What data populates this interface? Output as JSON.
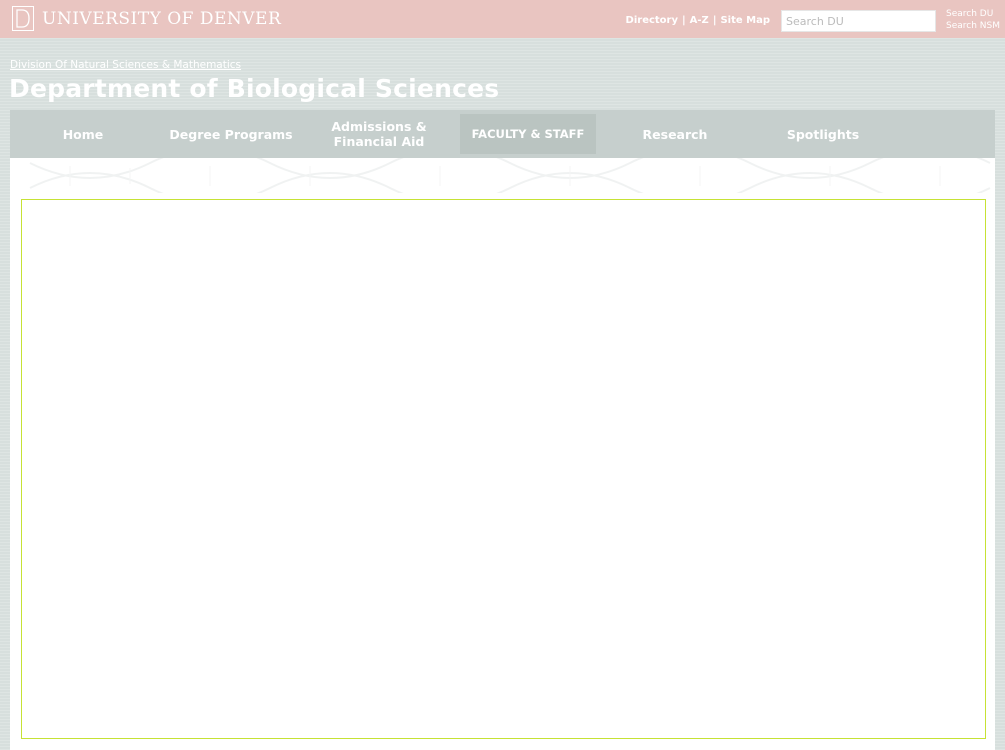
{
  "header": {
    "logo_text": "UNIVERSITY OF DENVER",
    "links": [
      "Directory",
      "A-Z",
      "Site Map"
    ],
    "search_placeholder": "Search DU",
    "search_options": [
      "Search DU",
      "Search NSM"
    ]
  },
  "breadcrumb": {
    "division": "Division Of Natural Sciences & Mathematics"
  },
  "page_title": "Department of Biological Sciences",
  "nav": {
    "items": [
      {
        "label": "Home"
      },
      {
        "label": "Degree Programs"
      },
      {
        "label": "Admissions & Financial Aid"
      },
      {
        "label": "FACULTY & STAFF"
      },
      {
        "label": "Research"
      },
      {
        "label": "Spotlights"
      }
    ]
  },
  "colors": {
    "topbar": "#e9c5c1",
    "nav": "#c6cfcd",
    "frame_border": "#c6e235"
  }
}
